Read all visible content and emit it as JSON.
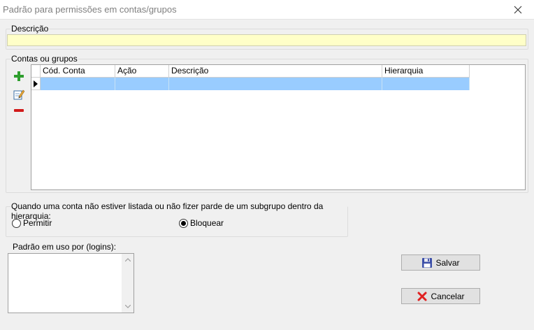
{
  "window": {
    "title": "Padrão para permissões em contas/grupos"
  },
  "descricao": {
    "label": "Descrição",
    "value": ""
  },
  "contas": {
    "label": "Contas ou grupos",
    "columns": [
      "Cód. Conta",
      "Ação",
      "Descrição",
      "Hierarquia"
    ],
    "rows": [
      {
        "cod": "",
        "acao": "",
        "descricao": "",
        "hierarquia": ""
      }
    ]
  },
  "policy": {
    "label": "Quando uma conta não estiver listada ou não fizer parde de um subgrupo dentro da hierarquia:",
    "options": [
      {
        "label": "Permitir",
        "selected": false
      },
      {
        "label": "Bloquear",
        "selected": true
      }
    ]
  },
  "logins": {
    "label": "Padrão em uso por (logins):"
  },
  "buttons": {
    "save": "Salvar",
    "cancel": "Cancelar"
  },
  "colors": {
    "selected_row": "#99ccff",
    "desc_field": "#ffffc8",
    "add": "#2e9e2e",
    "remove": "#d11a1a",
    "cancel": "#e02020"
  }
}
